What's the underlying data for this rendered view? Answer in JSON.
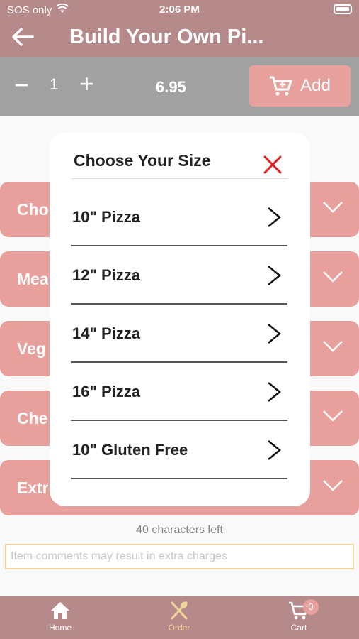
{
  "status_bar": {
    "carrier": "SOS only",
    "time": "2:06 PM"
  },
  "header": {
    "title": "Build Your Own Pi..."
  },
  "quantity": {
    "minus": "−",
    "value": "1",
    "plus": "+",
    "price": "6.95",
    "add_label": "Add"
  },
  "sections": [
    {
      "label": "Cho"
    },
    {
      "label": "Mea"
    },
    {
      "label": "Veg"
    },
    {
      "label": "Che"
    },
    {
      "label": "Extr"
    }
  ],
  "comments": {
    "chars_left": "40 characters left",
    "placeholder": "Item comments may result in extra charges"
  },
  "tab_bar": {
    "tabs": [
      {
        "label": "Home"
      },
      {
        "label": "Order"
      },
      {
        "label": "Cart"
      }
    ],
    "cart_badge": "0"
  },
  "modal": {
    "title": "Choose Your Size",
    "options": [
      {
        "label": "10\" Pizza"
      },
      {
        "label": "12\" Pizza"
      },
      {
        "label": "14\" Pizza"
      },
      {
        "label": "16\" Pizza"
      },
      {
        "label": "10\" Gluten Free"
      }
    ]
  },
  "colors": {
    "brand_dark": "#7a2a2d",
    "accent_red": "#d6524b",
    "accent_gold": "#e7b545",
    "close_red": "#e02020"
  }
}
